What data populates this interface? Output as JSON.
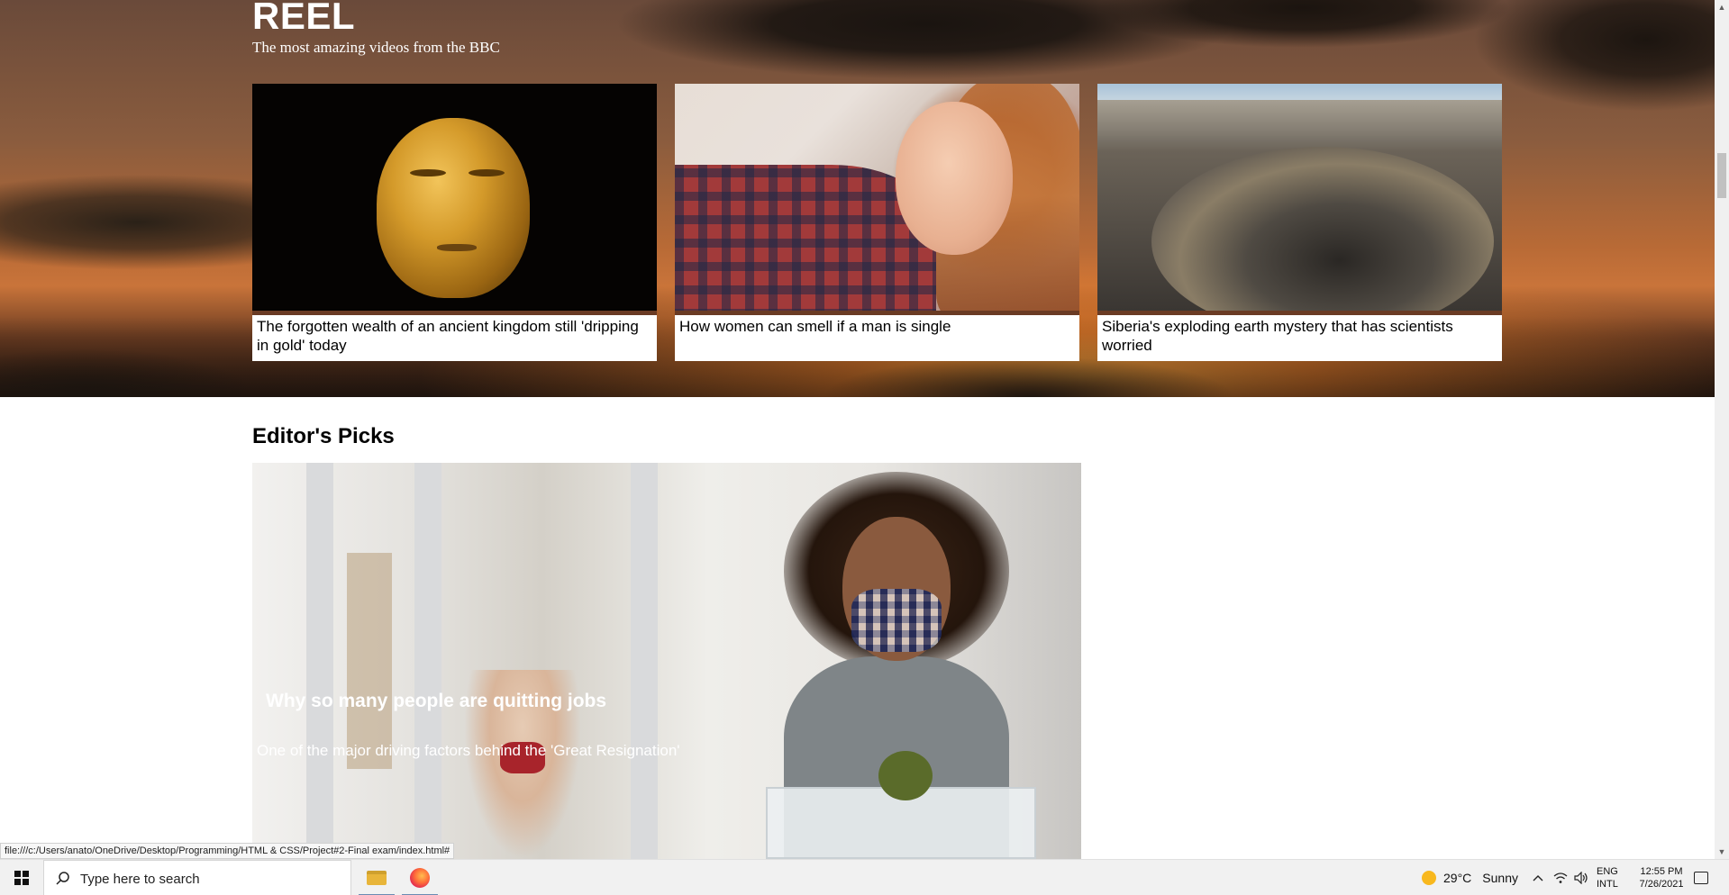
{
  "reel": {
    "title": "REEL",
    "subtitle": "The most amazing videos from the BBC",
    "cards": [
      {
        "caption": "The forgotten wealth of an ancient kingdom still 'dripping in gold' today"
      },
      {
        "caption": "How women can smell if a man is single"
      },
      {
        "caption": "Siberia's exploding earth mystery that has scientists worried"
      }
    ]
  },
  "editors_picks": {
    "heading": "Editor's Picks",
    "feature": {
      "title": "Why so many people are quitting jobs",
      "description": "One of the major driving factors behind the 'Great Resignation'"
    }
  },
  "status_bar": {
    "url": "file:///c:/Users/anato/OneDrive/Desktop/Programming/HTML & CSS/Project#2-Final exam/index.html#"
  },
  "taskbar": {
    "search_placeholder": "Type here to search",
    "apps": [
      "file-explorer",
      "firefox"
    ],
    "weather": {
      "temperature": "29°C",
      "condition": "Sunny"
    },
    "language": {
      "line1": "ENG",
      "line2": "INTL"
    },
    "clock": {
      "time": "12:55 PM",
      "date": "7/26/2021"
    }
  },
  "colors": {
    "caption_strip": "#6a3b24",
    "taskbar_bg": "#f1f1f1",
    "sun": "#f8b81e"
  }
}
